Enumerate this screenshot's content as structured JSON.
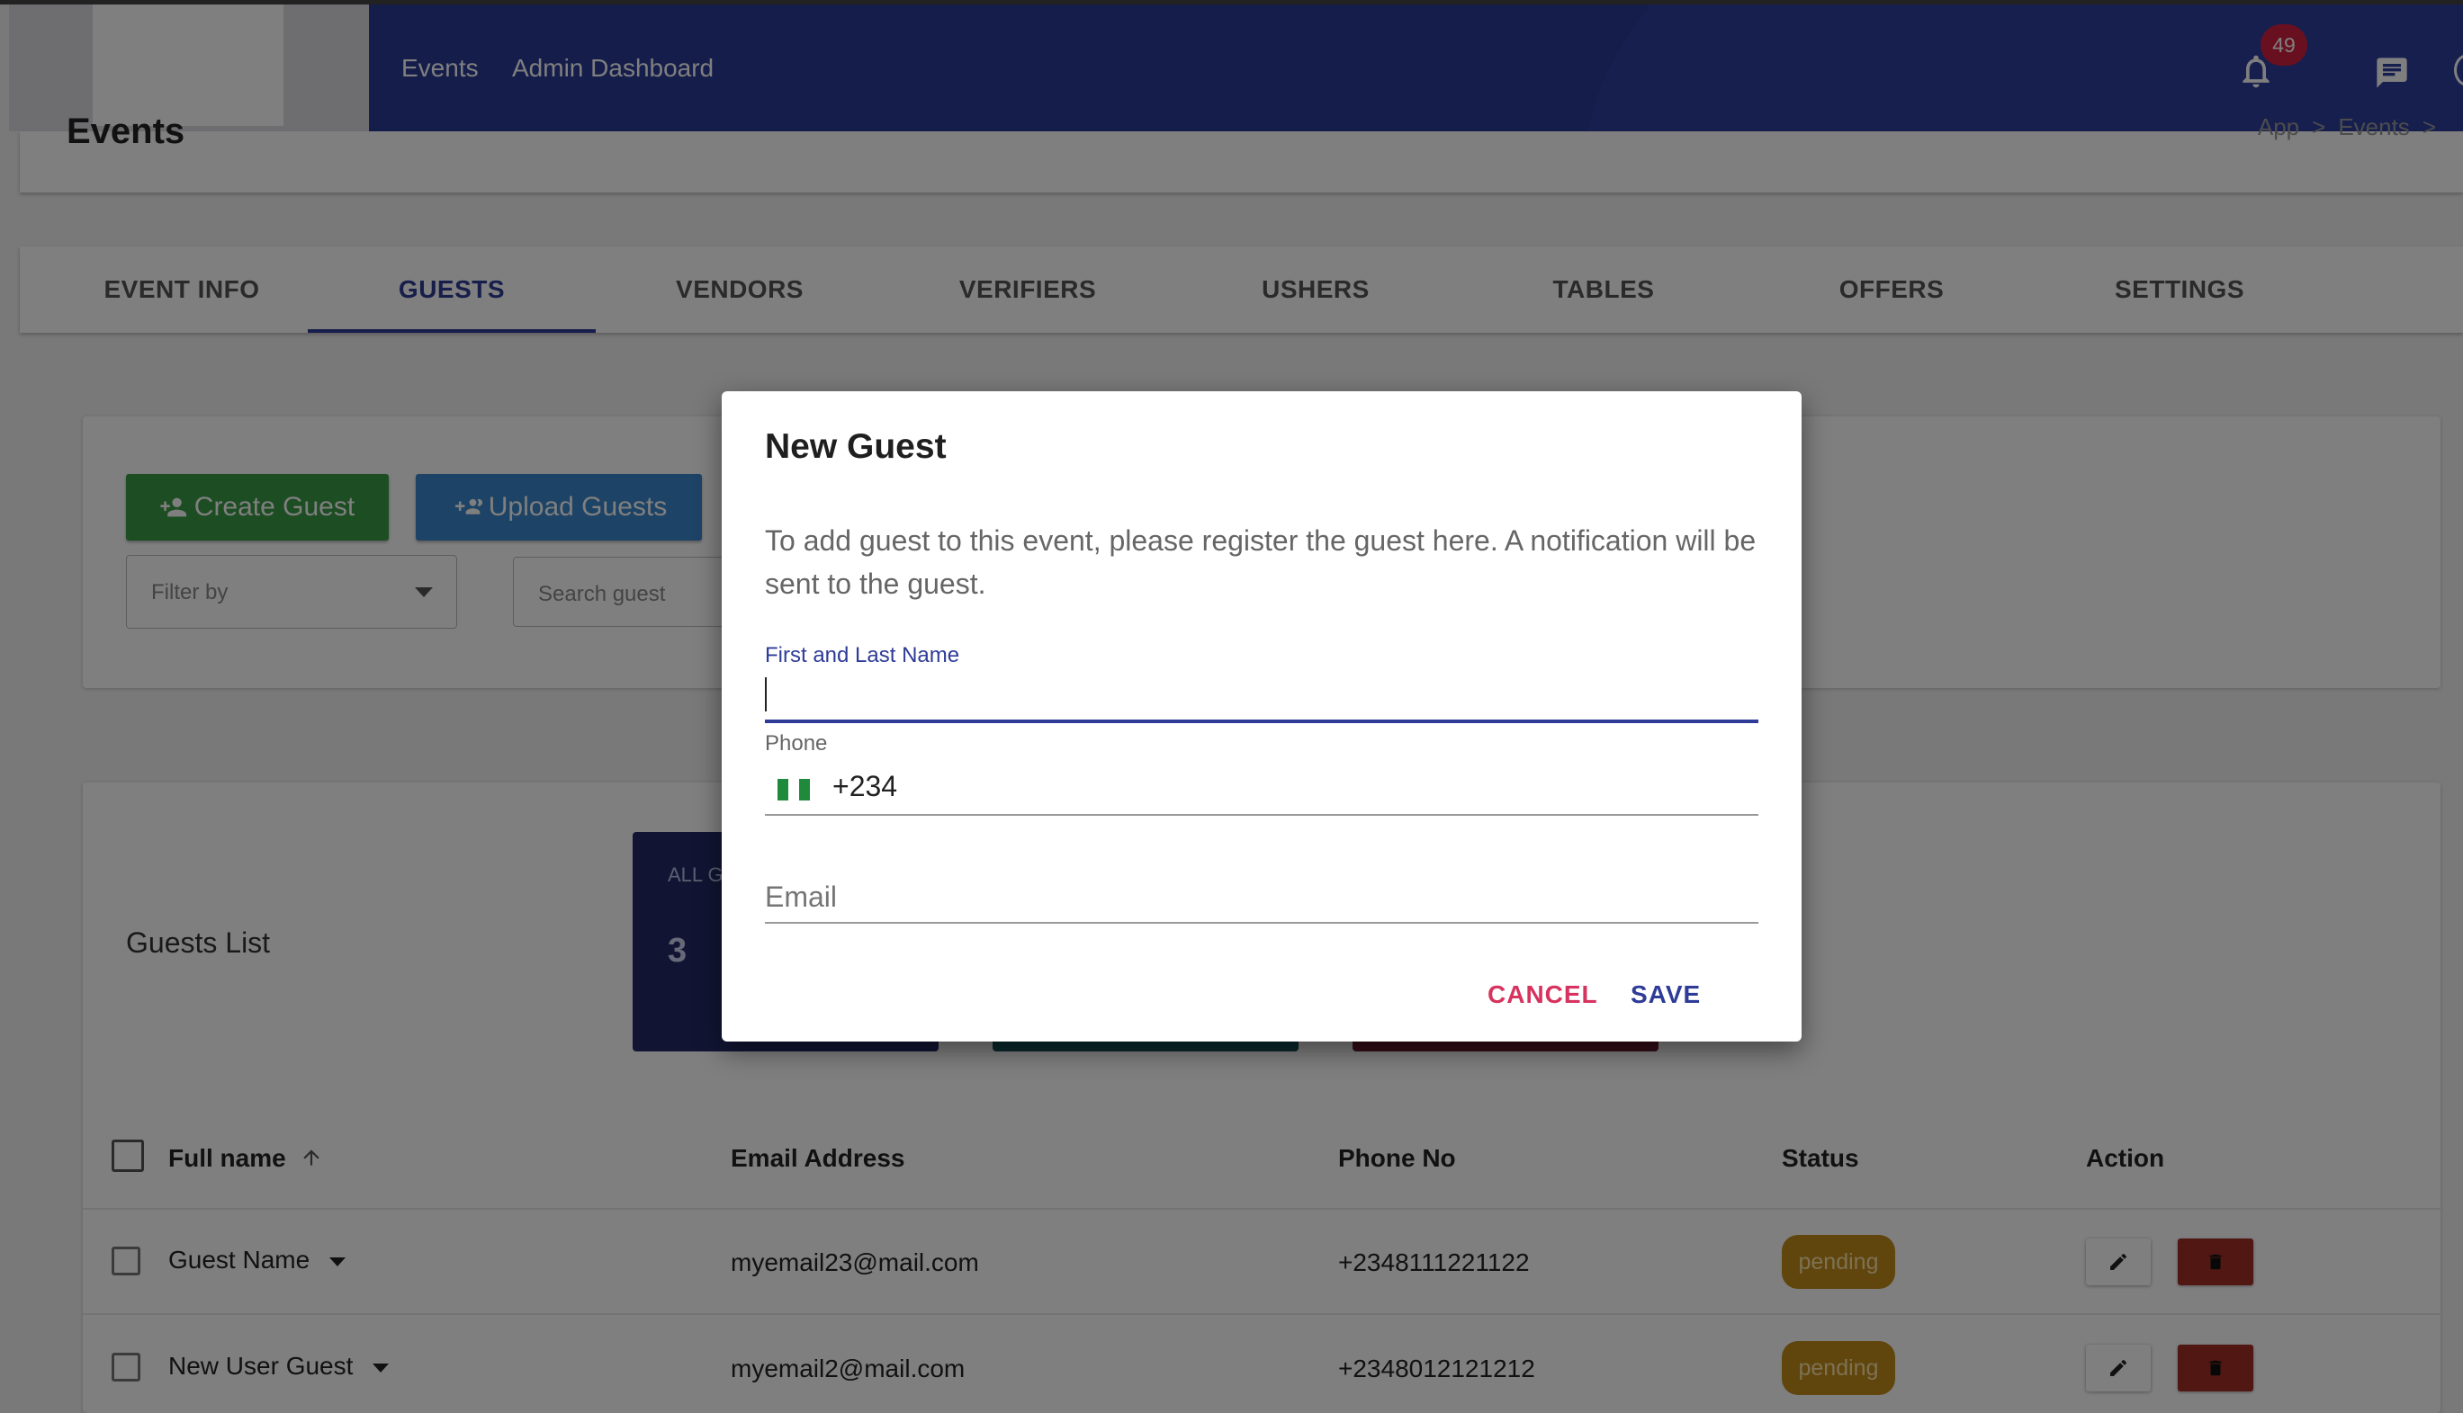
{
  "app": {
    "nav": [
      "Events",
      "Admin Dashboard"
    ],
    "notification_count": "49",
    "icons": [
      "bell-icon",
      "chat-icon"
    ]
  },
  "page": {
    "title": "Events",
    "breadcrumbs": [
      "App",
      ">",
      "Events",
      ">"
    ]
  },
  "tabs": [
    "EVENT INFO",
    "GUESTS",
    "VENDORS",
    "VERIFIERS",
    "USHERS",
    "TABLES",
    "OFFERS",
    "SETTINGS"
  ],
  "active_tab": "GUESTS",
  "actions": {
    "create_label": "Create Guest",
    "upload_label": "Upload Guests",
    "filter_placeholder": "Filter by",
    "search_placeholder": "Search guest"
  },
  "list": {
    "title": "Guests List",
    "stat_label": "ALL G",
    "stat_value": "3",
    "columns": [
      "Full name",
      "Email Address",
      "Phone No",
      "Status",
      "Action"
    ],
    "rows": [
      {
        "name": "Guest Name",
        "email": "myemail23@mail.com",
        "phone": "+2348111221122",
        "status": "pending"
      },
      {
        "name": "New User Guest",
        "email": "myemail2@mail.com",
        "phone": "+2348012121212",
        "status": "pending"
      }
    ]
  },
  "dialog": {
    "title": "New Guest",
    "text": "To add guest to this event, please register the guest here. A notification will be sent to the guest.",
    "name_label": "First and Last Name",
    "name_value": "",
    "phone_label": "Phone",
    "phone_value": "+234",
    "email_placeholder": "Email",
    "cancel_label": "CANCEL",
    "save_label": "SAVE"
  },
  "colors": {
    "primary": "#2e3c97",
    "appbar": "#2a3a96",
    "create_button": "#3b9a45",
    "upload_button": "#3a86cc",
    "cancel": "#d6335e",
    "pending": "#c08a1a",
    "delete": "#a32e25"
  }
}
